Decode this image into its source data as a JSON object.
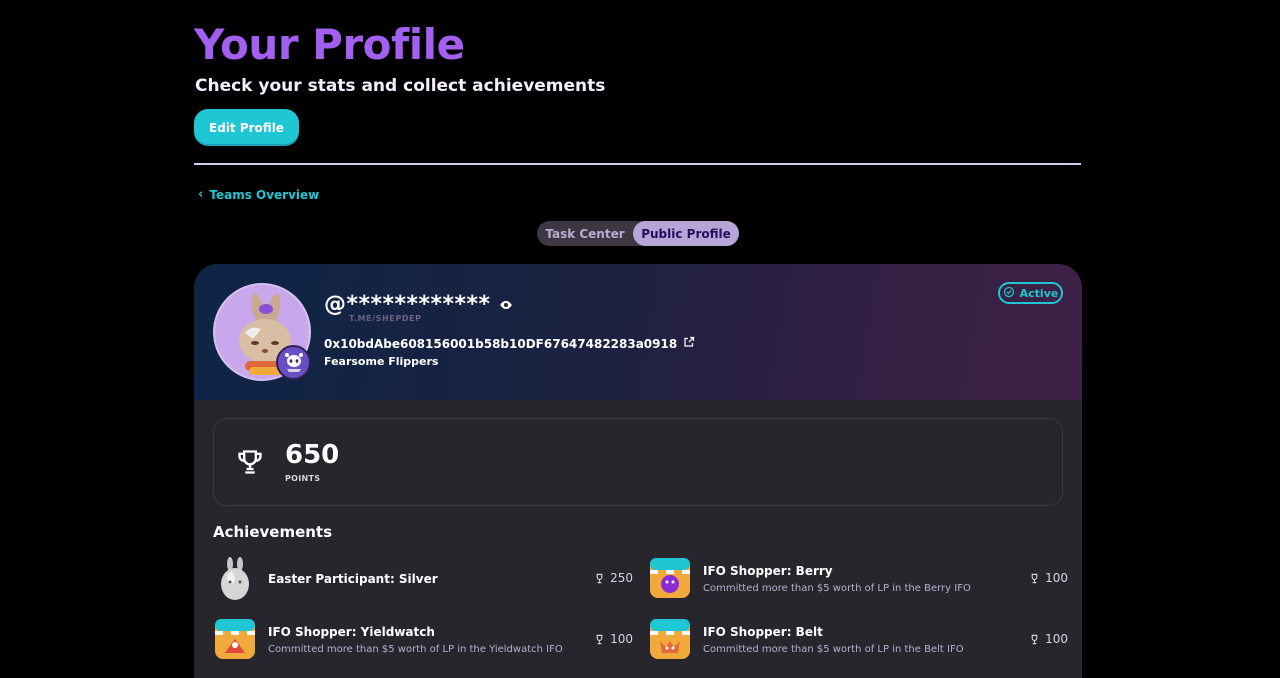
{
  "header": {
    "title": "Your Profile",
    "subtitle": "Check your stats and collect achievements",
    "edit_button": "Edit Profile"
  },
  "nav": {
    "back_label": "Teams Overview"
  },
  "tabs": [
    {
      "label": "Task Center",
      "active": false
    },
    {
      "label": "Public Profile",
      "active": true
    }
  ],
  "profile": {
    "username": "@************",
    "handle": "T.ME/SHEPDEP",
    "address": "0x10bdAbe608156001b58b10DF67647482283a0918",
    "team": "Fearsome Flippers",
    "status": "Active"
  },
  "points": {
    "value": "650",
    "label": "POINTS"
  },
  "achievements": {
    "title": "Achievements",
    "items": [
      {
        "name": "Easter Participant: Silver",
        "description": "",
        "points": "250",
        "icon": "silver-egg-icon"
      },
      {
        "name": "IFO Shopper: Berry",
        "description": "Committed more than $5 worth of LP in the Berry IFO",
        "points": "100",
        "icon": "ifo-berry-icon"
      },
      {
        "name": "IFO Shopper: Yieldwatch",
        "description": "Committed more than $5 worth of LP in the Yieldwatch IFO",
        "points": "100",
        "icon": "ifo-yieldwatch-icon"
      },
      {
        "name": "IFO Shopper: Belt",
        "description": "Committed more than $5 worth of LP in the Belt IFO",
        "points": "100",
        "icon": "ifo-belt-icon"
      }
    ]
  },
  "colors": {
    "accent_purple": "#a35ff0",
    "accent_cyan": "#1fc7d4",
    "card_bg": "#27262c"
  }
}
